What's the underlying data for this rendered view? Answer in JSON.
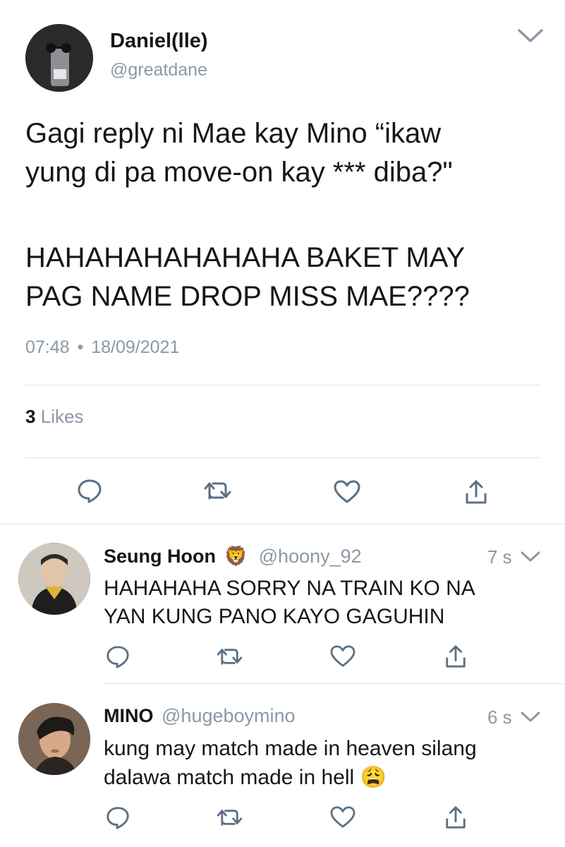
{
  "main_tweet": {
    "author": {
      "display_name": "Daniel(lle)",
      "handle": "@greatdane"
    },
    "text_lines": [
      "Gagi reply ni Mae kay Mino “ikaw",
      "yung di pa move-on kay *** diba?\"",
      "",
      "HAHAHAHAHAHAHA BAKET MAY",
      "PAG NAME DROP MISS MAE????"
    ],
    "time": "07:48",
    "separator": "•",
    "date": "18/09/2021",
    "likes_count": "3",
    "likes_label": "Likes",
    "actions": [
      "reply-icon",
      "retweet-icon",
      "like-icon",
      "share-icon"
    ]
  },
  "replies": [
    {
      "display_name": "Seung Hoon",
      "badge_emoji": "🦁",
      "handle": "@hoony_92",
      "time_ago": "7 s",
      "text_lines": [
        "HAHAHAHA SORRY NA TRAIN KO NA",
        "YAN KUNG PANO KAYO GAGUHIN"
      ]
    },
    {
      "display_name": "MINO",
      "handle": "@hugeboymino",
      "time_ago": "6 s",
      "text_lines": [
        "kung may match made in heaven silang",
        "dalawa match made in hell"
      ],
      "trailing_emoji": "😩"
    }
  ],
  "colors": {
    "text": "#14171a",
    "muted": "#8b98a5",
    "divider": "#dfe3e7",
    "icon": "#5b7083"
  }
}
